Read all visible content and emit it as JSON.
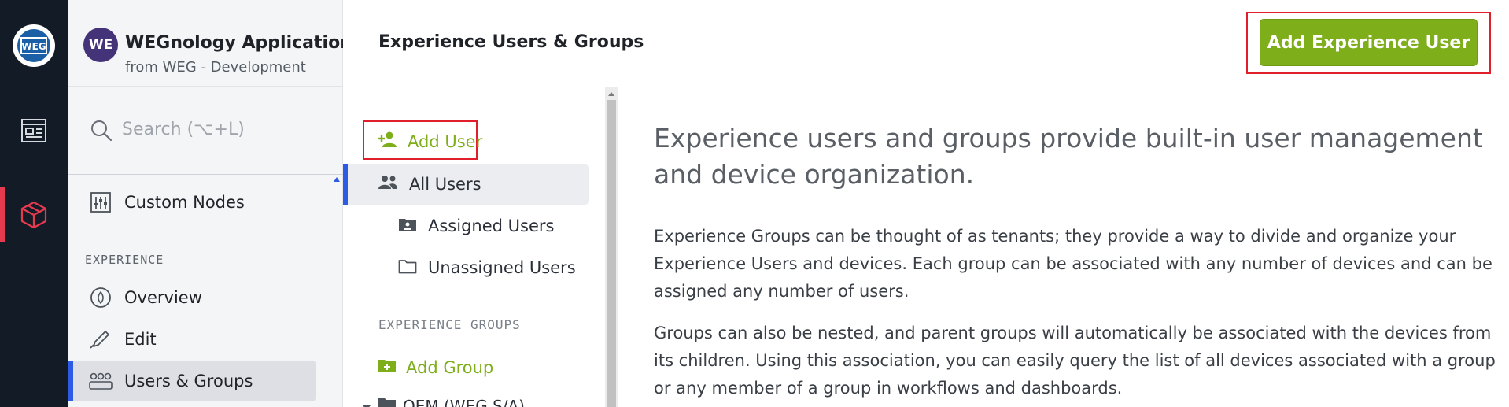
{
  "rail": {
    "items": [
      {
        "name": "logo",
        "label": "WEG"
      },
      {
        "name": "dashboards"
      },
      {
        "name": "applications"
      }
    ]
  },
  "app": {
    "avatar": "WE",
    "title": "WEGnology Application",
    "subtitle": "from WEG - Development"
  },
  "search": {
    "placeholder": "Search (⌥+L)"
  },
  "sidebar": {
    "items": [
      {
        "label": "Custom Nodes",
        "icon": "sliders-icon"
      },
      {
        "label": "Overview",
        "icon": "overview-icon"
      },
      {
        "label": "Edit",
        "icon": "pencil-icon"
      },
      {
        "label": "Users & Groups",
        "icon": "users-groups-icon",
        "active": true
      }
    ],
    "section_experience": "EXPERIENCE"
  },
  "header": {
    "title": "Experience Users & Groups",
    "primary_button": "Add Experience User"
  },
  "tree": {
    "add_user": "Add User",
    "all_users": "All Users",
    "assigned_users": "Assigned Users",
    "unassigned_users": "Unassigned Users",
    "section_groups": "EXPERIENCE GROUPS",
    "add_group": "Add Group",
    "first_group": "OEM (WEG S/A)"
  },
  "content": {
    "lead": "Experience users and groups provide built-in user management and device organization.",
    "para1": "Experience Groups can be thought of as tenants; they provide a way to divide and organize your Experience Users and devices. Each group can be associated with any number of devices and can be assigned any number of users.",
    "para2": "Groups can also be nested, and parent groups will automatically be associated with the devices from its children. Using this association, you can easily query the list of all devices associated with a group or any member of a group in workflows and dashboards."
  },
  "colors": {
    "accent_green": "#7fae1b",
    "active_blue": "#2d5be3",
    "rail_active_red": "#e53a4f",
    "rail_bg": "#131b26",
    "highlight_red": "#e01f2a"
  }
}
